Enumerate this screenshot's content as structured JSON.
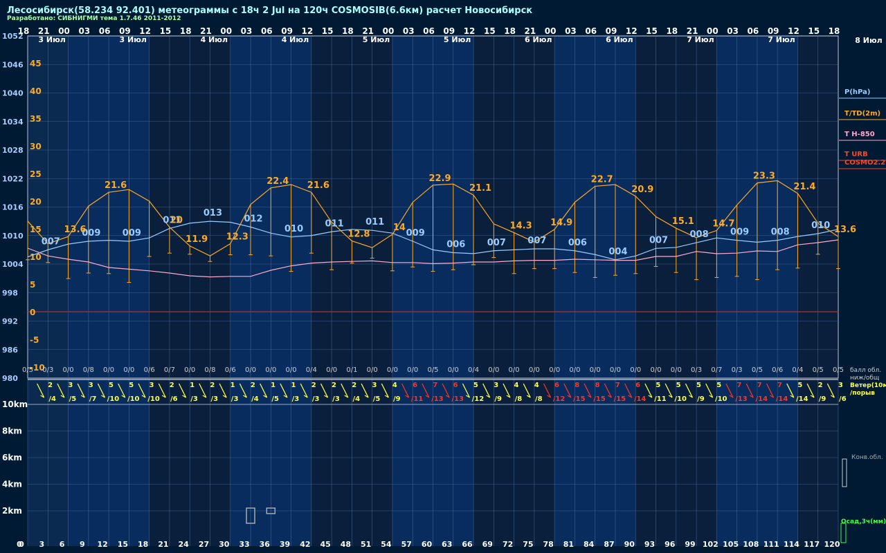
{
  "header": {
    "title": "Лесосибирск(58.234 92.401) метеограммы с  18ч 2 Jul на 120ч COSMOSIB(6.6км) расчет Новосибирск",
    "subtitle": "Разработано: СИБНИГМИ тема 1.7.46 2011-2012"
  },
  "chart_data": {
    "type": "line",
    "hour_labels": [
      "18",
      "21",
      "00",
      "03",
      "06",
      "09",
      "12",
      "15",
      "18",
      "21",
      "00",
      "03",
      "06",
      "09",
      "12",
      "15",
      "18",
      "21",
      "00",
      "03",
      "06",
      "09",
      "12",
      "15",
      "18",
      "21",
      "00",
      "03",
      "06",
      "09",
      "12",
      "15",
      "18",
      "21",
      "00",
      "03",
      "06",
      "09",
      "12",
      "15",
      "18"
    ],
    "date_labels": [
      {
        "step": 1.2,
        "text": "3 Июл"
      },
      {
        "step": 5.2,
        "text": "3 Июл"
      },
      {
        "step": 9.2,
        "text": "4 Июл"
      },
      {
        "step": 13.2,
        "text": "4 Июл"
      },
      {
        "step": 17.2,
        "text": "5 Июл"
      },
      {
        "step": 21.2,
        "text": "5 Июл"
      },
      {
        "step": 25.2,
        "text": "6 Июл"
      },
      {
        "step": 29.2,
        "text": "6 Июл"
      },
      {
        "step": 33.2,
        "text": "7 Июл"
      },
      {
        "step": 37.2,
        "text": "7 Июл"
      }
    ],
    "date_label_right": "8 Июл",
    "forecast_hours": [
      "0",
      "3",
      "6",
      "9",
      "12",
      "15",
      "18",
      "21",
      "24",
      "27",
      "30",
      "33",
      "36",
      "39",
      "42",
      "45",
      "48",
      "51",
      "54",
      "57",
      "60",
      "63",
      "66",
      "69",
      "72",
      "75",
      "78",
      "81",
      "84",
      "87",
      "90",
      "93",
      "96",
      "99",
      "102",
      "105",
      "108",
      "111",
      "114",
      "117",
      "120"
    ],
    "pressure_axis_ticks": [
      "1052",
      "1046",
      "1040",
      "1034",
      "1028",
      "1022",
      "1016",
      "1010",
      "1004",
      "998",
      "992",
      "986",
      "980"
    ],
    "temperature_axis_ticks": [
      "45",
      "40",
      "35",
      "30",
      "25",
      "20",
      "15",
      "10",
      "5",
      "0",
      "-5",
      "-10"
    ],
    "pressure_range": [
      980,
      1052
    ],
    "temperature_range": [
      -15,
      50
    ],
    "height_axis_ticks": [
      "10km",
      "8km",
      "6km",
      "4km",
      "2km"
    ],
    "series": [
      {
        "name": "P(hPa)",
        "color": "#99ccff",
        "label_values": [
          "007",
          "009",
          "009",
          "011",
          "013",
          "012",
          "010",
          "011",
          "011",
          "009",
          "006",
          "007",
          "007",
          "006",
          "004",
          "007",
          "008",
          "009",
          "008",
          "010"
        ],
        "label_steps": [
          1,
          3,
          5,
          7,
          9,
          11,
          13,
          15,
          17,
          19,
          21,
          23,
          25,
          27,
          29,
          31,
          33,
          35,
          37,
          39
        ],
        "values": [
          1005.5,
          1007,
          1008.2,
          1008.8,
          1009,
          1008.8,
          1009.5,
          1011.5,
          1012.6,
          1013,
          1012.8,
          1011.8,
          1010.5,
          1009.7,
          1010,
          1010.8,
          1011.3,
          1011.1,
          1010.5,
          1008.8,
          1007,
          1006.4,
          1006.2,
          1006.8,
          1007,
          1007.2,
          1007.2,
          1006.8,
          1006,
          1004.9,
          1005.7,
          1007.3,
          1007.5,
          1008.5,
          1009.5,
          1009,
          1008.6,
          1009,
          1009.8,
          1010.4,
          1011.3
        ]
      },
      {
        "name": "T/TD(2m)",
        "color": "#ffaa22",
        "values": [
          16.4,
          12.3,
          13.6,
          19.1,
          21.6,
          22.1,
          20,
          15.3,
          11.9,
          10.1,
          12.3,
          19.4,
          22.4,
          23,
          21.6,
          16.2,
          12.8,
          11.6,
          14,
          19.8,
          22.9,
          23.1,
          21.1,
          15.9,
          14.3,
          12.6,
          14.9,
          19.8,
          22.7,
          23,
          20.9,
          17.2,
          15.1,
          13.4,
          14.7,
          19.3,
          23.3,
          23.7,
          21.4,
          16,
          13.6
        ],
        "maxima": {
          "4": "21.6",
          "7": "20",
          "8": "11.9",
          "10": "12.3",
          "12": "22.4",
          "14": "21.6",
          "16": "12.8",
          "18": "14",
          "20": "22.9",
          "22": "21.1",
          "24": "14.3",
          "26": "14.9",
          "28": "22.7",
          "30": "20.9",
          "32": "15.1",
          "34": "14.7",
          "36": "23.3",
          "38": "21.4",
          "40": "13.6",
          "2": "13.6"
        }
      },
      {
        "name": "T H-850",
        "color": "#ffaacc",
        "values": [
          11.5,
          10.1,
          9.5,
          9,
          8,
          7.7,
          7.4,
          7,
          6.5,
          6.3,
          6.4,
          6.4,
          7.5,
          8.3,
          8.8,
          9,
          9.1,
          9.2,
          8.9,
          8.9,
          8.7,
          8.8,
          9,
          9,
          9.2,
          9.3,
          9.3,
          9.5,
          9.4,
          9.3,
          9.3,
          10,
          10,
          10.9,
          10.5,
          10.6,
          11,
          10.9,
          12.1,
          12.5,
          13
        ]
      }
    ],
    "dewpoint_bars": [
      9.4,
      8.9,
      6,
      7,
      6.9,
      5.3,
      10,
      10.6,
      10.4,
      9.1,
      10.3,
      10.3,
      10.1,
      7.3,
      10.6,
      7.6,
      8.8,
      9.7,
      7.4,
      8.1,
      7.3,
      7.6,
      8.5,
      9.8,
      6.9,
      7.8,
      7.8,
      7.1,
      6.2,
      6.6,
      6.9,
      8.2,
      7.1,
      5.8,
      6.2,
      6.4,
      5.8,
      7.6,
      7.9,
      10.4,
      7.8
    ],
    "cloud_labels": [
      "0/5",
      "0/3",
      "0/0",
      "0/8",
      "0/0",
      "0/0",
      "0/6",
      "0/7",
      "0/0",
      "0/8",
      "0/6",
      "0/0",
      "0/0",
      "0/0",
      "0/4",
      "0/0",
      "0/1",
      "0/0",
      "0/0",
      "0/0",
      "0/5",
      "0/0",
      "0/4",
      "0/0",
      "0/0",
      "0/0",
      "0/0",
      "0/0",
      "0/0",
      "0/0",
      "0/0",
      "0/0",
      "0/0",
      "0/3",
      "0/7",
      "0/3",
      "0/5",
      "0/6",
      "0/4",
      "0/5",
      "0/5"
    ],
    "wind_speed": [
      "2",
      "3",
      "3",
      "5",
      "5",
      "3",
      "2",
      "1",
      "2",
      "1",
      "2",
      "1",
      "1",
      "2",
      "2",
      "2",
      "3",
      "4",
      "6",
      "7",
      "6",
      "5",
      "3",
      "4",
      "4",
      "6",
      "8",
      "8",
      "7",
      "6",
      "5",
      "5",
      "5",
      "5",
      "7",
      "7",
      "7",
      "5",
      "2",
      "3"
    ],
    "wind_gust": [
      "/4",
      "/5",
      "/7",
      "/10",
      "/10",
      "/10",
      "/6",
      "/3",
      "/3",
      "/3",
      "/4",
      "/5",
      "/3",
      "/3",
      "/3",
      "/4",
      "/5",
      "/9",
      "/11",
      "/13",
      "/13",
      "/12",
      "/9",
      "/8",
      "/8",
      "/12",
      "/15",
      "/15",
      "/15",
      "/14",
      "/11",
      "/10",
      "/9",
      "/10",
      "/13",
      "/14",
      "/14",
      "/14",
      "/9",
      "/6"
    ],
    "legend": [
      "P(hPa)",
      "T/TD(2m)",
      "T H-850",
      "T URB",
      "COSMO2.2"
    ],
    "right_labels": {
      "cloud": "балл обл.",
      "cloud2": "ниж/общ",
      "wind": "Ветер(10м)",
      "wind2": "/порыв",
      "conv": "Конв.обл.",
      "precip": "Осад,3ч(мм)"
    }
  },
  "colors": {
    "background": "#001a33",
    "pressure": "#99ccff",
    "temperature": "#ffaa22",
    "h850": "#ffaacc",
    "urb": "#ff4422",
    "cosmo": "#ff4422",
    "zero_line": "#aa3333",
    "wind_weak": "#ffff44",
    "wind_strong": "#ff3322",
    "grid": "#5577aa"
  }
}
